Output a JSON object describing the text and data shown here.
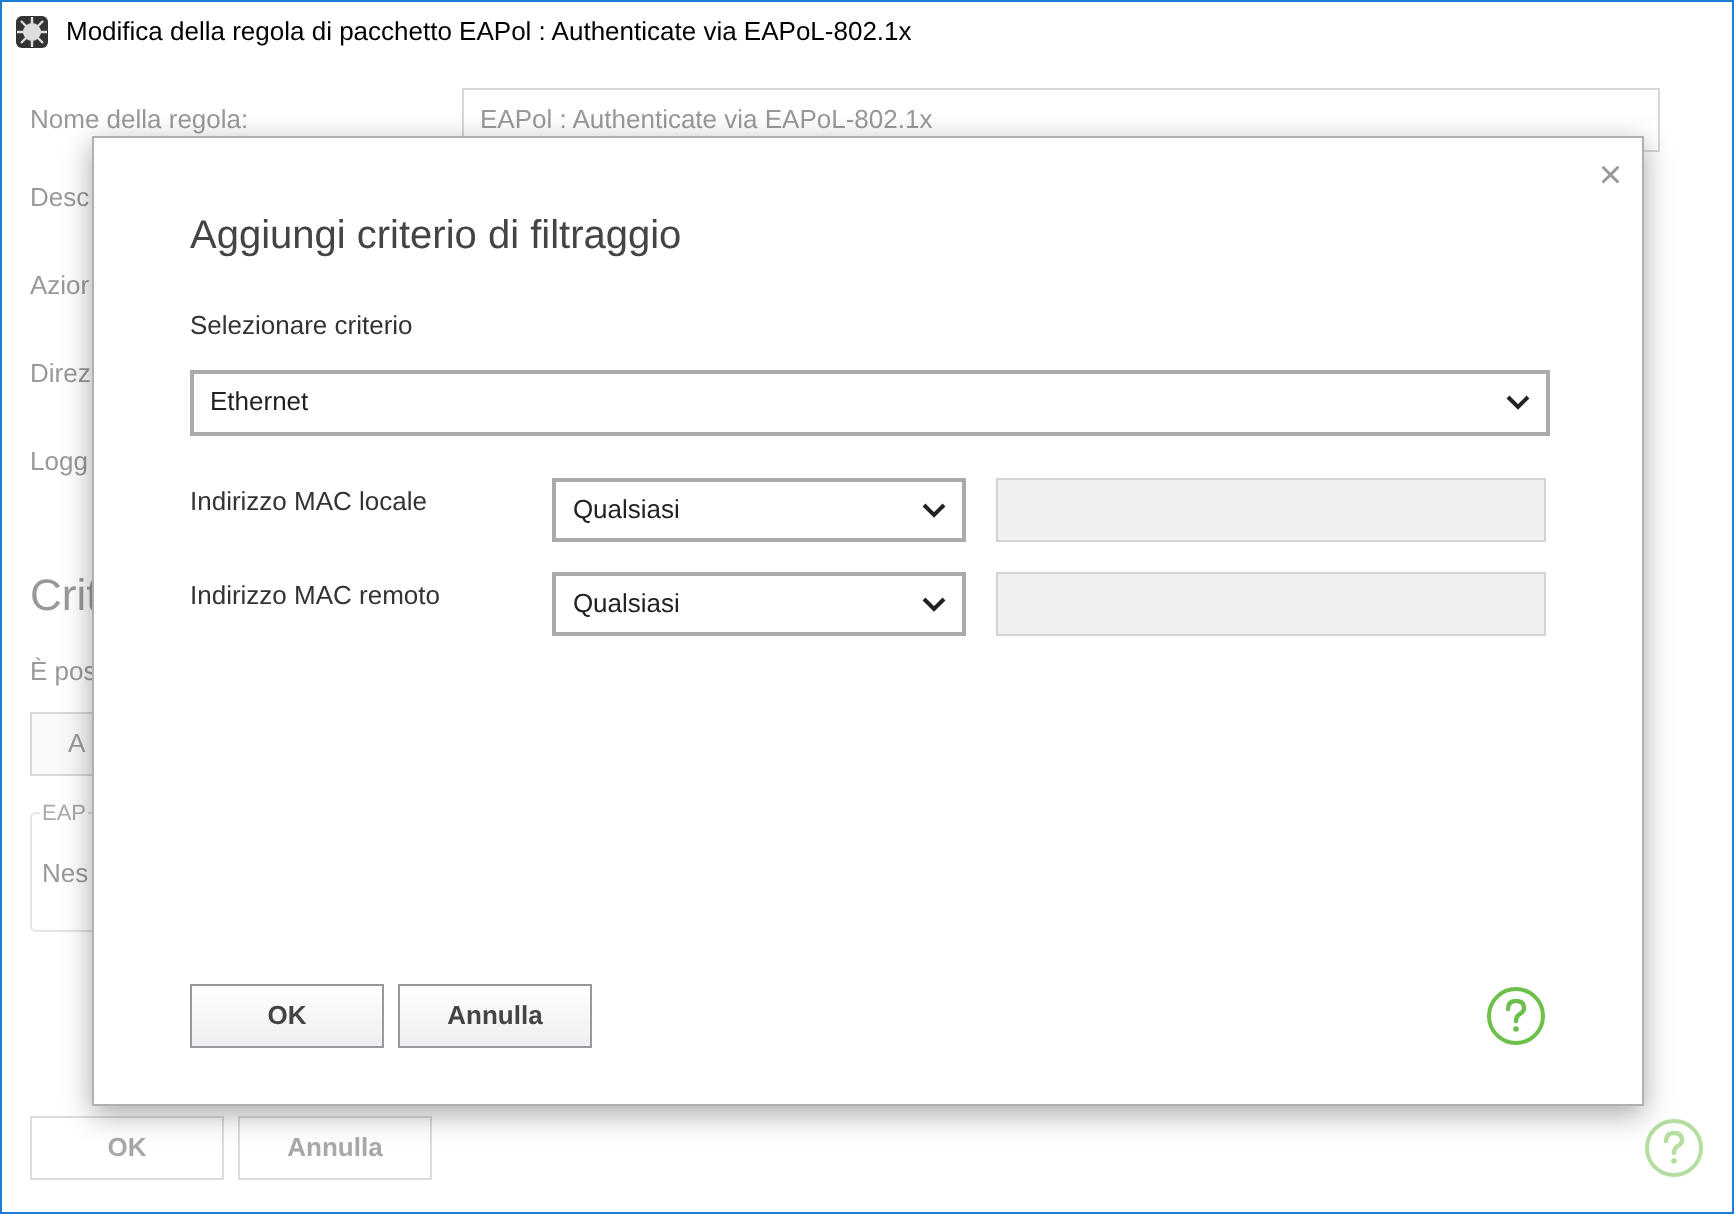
{
  "window": {
    "title": "Modifica della regola di pacchetto EAPol : Authenticate via EAPoL-802.1x"
  },
  "background": {
    "rule_name_label": "Nome della regola:",
    "rule_name_value": "EAPol : Authenticate via EAPoL-802.1x",
    "labels": [
      "Desc",
      "Azior",
      "Direz",
      "Logg"
    ],
    "section_heading": "Crit",
    "section_text": "È pos",
    "add_button": "A",
    "group_title": "EAP",
    "group_text": "Nes",
    "buttons": [
      {
        "label": "OK",
        "disabled": true
      },
      {
        "label": "Annulla",
        "disabled": true
      }
    ]
  },
  "dialog": {
    "title": "Aggiungi criterio di filtraggio",
    "close": "×",
    "criterion_label": "Selezionare criterio",
    "criterion_value": "Ethernet",
    "rows": [
      {
        "label": "Indirizzo MAC locale",
        "value": "Qualsiasi",
        "disabled": true
      },
      {
        "label": "Indirizzo MAC remoto",
        "value": "Qualsiasi",
        "disabled": true
      }
    ],
    "buttons": [
      {
        "label": "OK"
      },
      {
        "label": "Annulla"
      }
    ]
  }
}
